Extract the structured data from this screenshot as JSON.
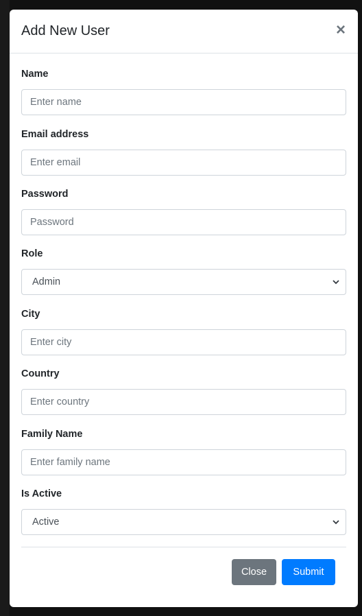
{
  "modal": {
    "title": "Add New User",
    "close_symbol": "×"
  },
  "fields": {
    "name": {
      "label": "Name",
      "placeholder": "Enter name"
    },
    "email": {
      "label": "Email address",
      "placeholder": "Enter email"
    },
    "password": {
      "label": "Password",
      "placeholder": "Password"
    },
    "role": {
      "label": "Role",
      "value": "Admin"
    },
    "city": {
      "label": "City",
      "placeholder": "Enter city"
    },
    "country": {
      "label": "Country",
      "placeholder": "Enter country"
    },
    "family_name": {
      "label": "Family Name",
      "placeholder": "Enter family name"
    },
    "is_active": {
      "label": "Is Active",
      "value": "Active"
    }
  },
  "footer": {
    "close_label": "Close",
    "submit_label": "Submit"
  },
  "colors": {
    "primary": "#007bff",
    "secondary": "#6c757d"
  }
}
